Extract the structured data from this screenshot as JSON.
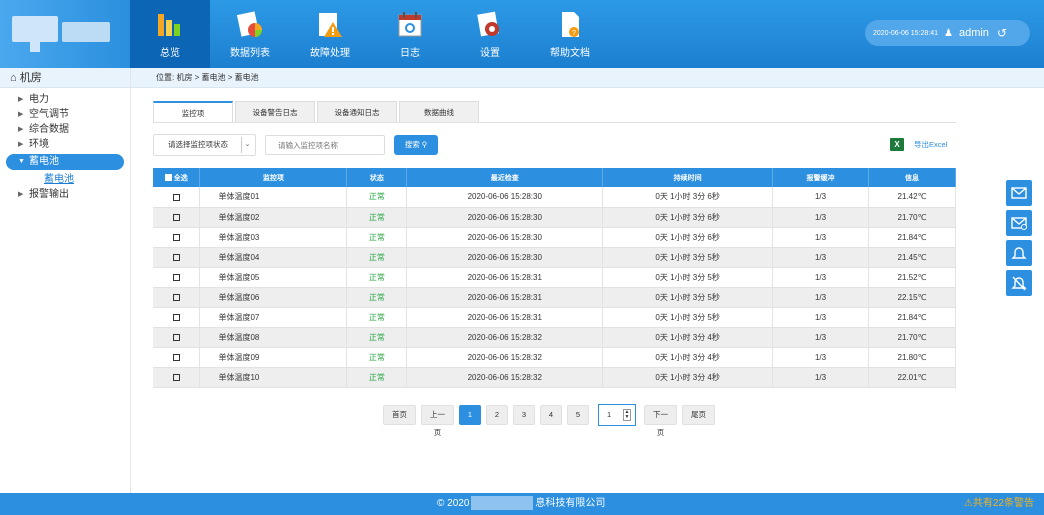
{
  "nav": {
    "items": [
      {
        "label": "总览",
        "icon": "overview-icon",
        "active": true
      },
      {
        "label": "数据列表",
        "icon": "data-list-icon",
        "active": false
      },
      {
        "label": "故障处理",
        "icon": "fault-icon",
        "active": false
      },
      {
        "label": "日志",
        "icon": "log-icon",
        "active": false
      },
      {
        "label": "设置",
        "icon": "settings-icon",
        "active": false
      },
      {
        "label": "帮助文档",
        "icon": "help-doc-icon",
        "active": false
      }
    ]
  },
  "header": {
    "datetime": "2020-06-06 15:28:41",
    "user": "admin"
  },
  "sidebar": {
    "root": "机房",
    "items": [
      {
        "label": "电力"
      },
      {
        "label": "空气调节"
      },
      {
        "label": "综合数据"
      },
      {
        "label": "环境"
      },
      {
        "label": "蓄电池"
      },
      {
        "label": "蓄电池"
      },
      {
        "label": "报警输出"
      }
    ]
  },
  "breadcrumb": "位置:  机房 > 蓄电池 > 蓄电池",
  "tabs": [
    {
      "label": "监控项"
    },
    {
      "label": "设备警告日志"
    },
    {
      "label": "设备通知日志"
    },
    {
      "label": "数据曲线"
    }
  ],
  "filter": {
    "status_label": "请选择监控项状态",
    "dropdown_arrow": "⌄",
    "name_placeholder": "请输入监控项名称",
    "search_label": "搜索",
    "export_label": "导出Excel",
    "export_icon_text": "X"
  },
  "table": {
    "headers": [
      "全选",
      "监控项",
      "状态",
      "最近检查",
      "持续时间",
      "报警缓冲",
      "信息"
    ],
    "rows": [
      {
        "name": "单体温度01",
        "status": "正常",
        "last_check": "2020-06-06 15:28:30",
        "duration": "0天 1小时 3分 6秒",
        "buffer": "1/3",
        "info": "21.42℃"
      },
      {
        "name": "单体温度02",
        "status": "正常",
        "last_check": "2020-06-06 15:28:30",
        "duration": "0天 1小时 3分 6秒",
        "buffer": "1/3",
        "info": "21.70℃"
      },
      {
        "name": "单体温度03",
        "status": "正常",
        "last_check": "2020-06-06 15:28:30",
        "duration": "0天 1小时 3分 6秒",
        "buffer": "1/3",
        "info": "21.84℃"
      },
      {
        "name": "单体温度04",
        "status": "正常",
        "last_check": "2020-06-06 15:28:30",
        "duration": "0天 1小时 3分 5秒",
        "buffer": "1/3",
        "info": "21.45℃"
      },
      {
        "name": "单体温度05",
        "status": "正常",
        "last_check": "2020-06-06 15:28:31",
        "duration": "0天 1小时 3分 5秒",
        "buffer": "1/3",
        "info": "21.52℃"
      },
      {
        "name": "单体温度06",
        "status": "正常",
        "last_check": "2020-06-06 15:28:31",
        "duration": "0天 1小时 3分 5秒",
        "buffer": "1/3",
        "info": "22.15℃"
      },
      {
        "name": "单体温度07",
        "status": "正常",
        "last_check": "2020-06-06 15:28:31",
        "duration": "0天 1小时 3分 5秒",
        "buffer": "1/3",
        "info": "21.84℃"
      },
      {
        "name": "单体温度08",
        "status": "正常",
        "last_check": "2020-06-06 15:28:32",
        "duration": "0天 1小时 3分 4秒",
        "buffer": "1/3",
        "info": "21.70℃"
      },
      {
        "name": "单体温度09",
        "status": "正常",
        "last_check": "2020-06-06 15:28:32",
        "duration": "0天 1小时 3分 4秒",
        "buffer": "1/3",
        "info": "21.80℃"
      },
      {
        "name": "单体温度10",
        "status": "正常",
        "last_check": "2020-06-06 15:28:32",
        "duration": "0天 1小时 3分 4秒",
        "buffer": "1/3",
        "info": "22.01℃"
      }
    ]
  },
  "pager": {
    "first": "首页",
    "prev": "上一页",
    "pages": [
      "1",
      "2",
      "3",
      "4",
      "5"
    ],
    "current": "1",
    "jump_value": "1",
    "next": "下一页",
    "last": "尾页"
  },
  "side_tools": [
    {
      "icon": "mail-icon"
    },
    {
      "icon": "mail-settings-icon"
    },
    {
      "icon": "bell-icon"
    },
    {
      "icon": "bell-off-icon"
    }
  ],
  "footer": {
    "copyright_start": "© 2020",
    "copyright_end": "息科技有限公司",
    "alarm": "共有22条警告"
  },
  "colors": {
    "primary": "#2d8fe0",
    "nav_active": "#0c65b5",
    "status_ok": "#27a844",
    "alarm": "#f5b31b"
  }
}
